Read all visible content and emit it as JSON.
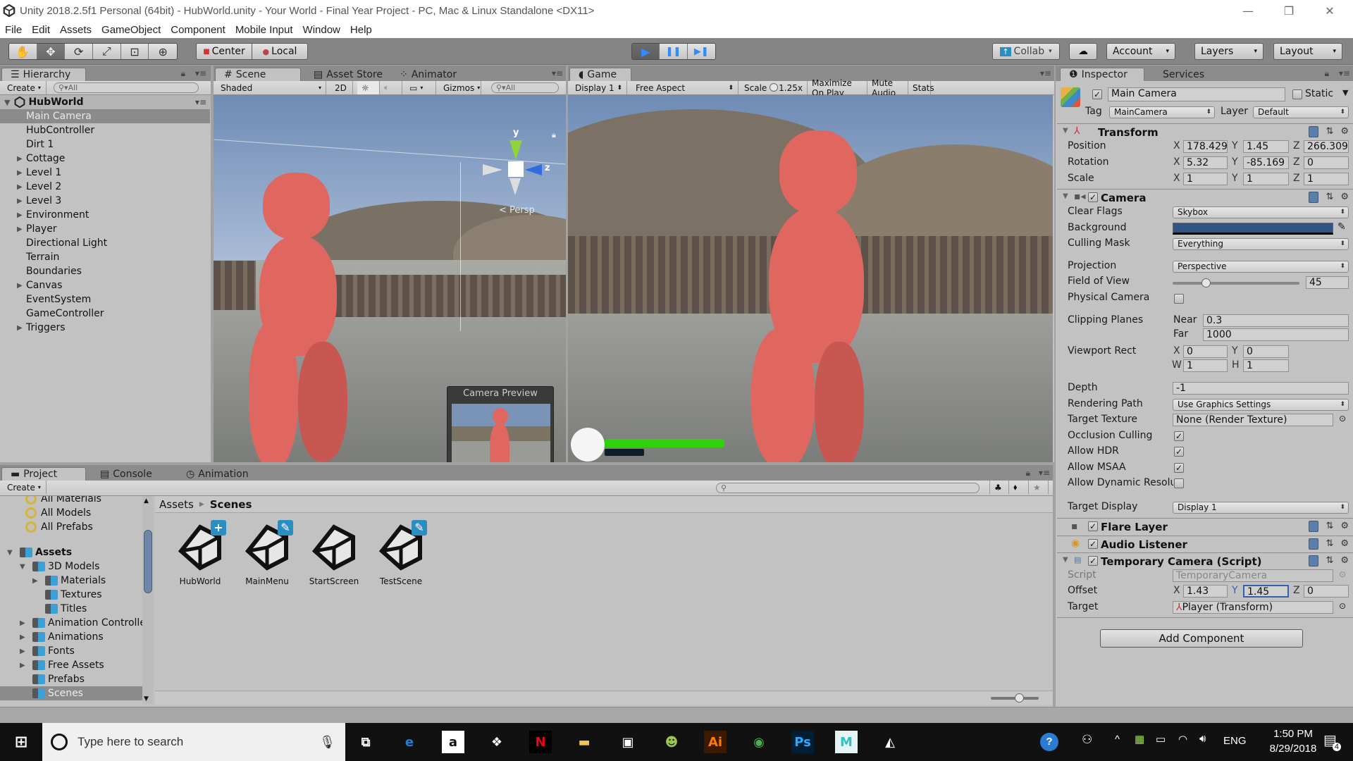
{
  "window": {
    "title": "Unity 2018.2.5f1 Personal (64bit) - HubWorld.unity - Your World - Final Year Project - PC, Mac & Linux Standalone <DX11>",
    "controls": {
      "minimize": "—",
      "maximize": "❐",
      "close": "✕"
    }
  },
  "menu": [
    "File",
    "Edit",
    "Assets",
    "GameObject",
    "Component",
    "Mobile Input",
    "Window",
    "Help"
  ],
  "toolbar": {
    "tools": [
      "hand-tool",
      "move-tool",
      "rotate-tool",
      "scale-tool",
      "rect-tool",
      "transform-tool"
    ],
    "tool_glyphs": [
      "✋",
      "✥",
      "⟳",
      "⤢",
      "⊡",
      "⊕"
    ],
    "pivot": "Center",
    "space": "Local",
    "play": "▶",
    "pause": "❚❚",
    "step": "▶❚",
    "collab": "Collab",
    "cloud": "☁",
    "account": "Account",
    "layers": "Layers",
    "layout": "Layout"
  },
  "hierarchy": {
    "tab": "Hierarchy",
    "create": "Create",
    "search_placeholder": "All",
    "scene": "HubWorld",
    "items": [
      {
        "label": "Main Camera",
        "expandable": false,
        "selected": true
      },
      {
        "label": "HubController",
        "expandable": false
      },
      {
        "label": "Dirt 1",
        "expandable": false
      },
      {
        "label": "Cottage",
        "expandable": true
      },
      {
        "label": "Level 1",
        "expandable": true
      },
      {
        "label": "Level 2",
        "expandable": true
      },
      {
        "label": "Level 3",
        "expandable": true
      },
      {
        "label": "Environment",
        "expandable": true
      },
      {
        "label": "Player",
        "expandable": true
      },
      {
        "label": "Directional Light",
        "expandable": false
      },
      {
        "label": "Terrain",
        "expandable": false
      },
      {
        "label": "Boundaries",
        "expandable": false
      },
      {
        "label": "Canvas",
        "expandable": true
      },
      {
        "label": "EventSystem",
        "expandable": false
      },
      {
        "label": "GameController",
        "expandable": false
      },
      {
        "label": "Triggers",
        "expandable": true
      }
    ]
  },
  "scene_view": {
    "tabs": [
      "Scene",
      "Asset Store",
      "Animator"
    ],
    "shading": "Shaded",
    "mode_2d": "2D",
    "gizmos": "Gizmos",
    "search_placeholder": "All",
    "gizmo_labels": {
      "y": "y",
      "z": "z",
      "persp": "< Persp"
    },
    "camera_preview_title": "Camera Preview"
  },
  "game_view": {
    "tab": "Game",
    "display": "Display 1",
    "aspect": "Free Aspect",
    "scale_label": "Scale",
    "scale_value": "1.25x",
    "maximize_on_play": "Maximize On Play",
    "mute_audio": "Mute Audio",
    "stats": "Stats",
    "health_fraction": 1.0,
    "stamina_fraction": 0.33,
    "health_color": "#2fd10d"
  },
  "inspector": {
    "tabs": [
      "Inspector",
      "Services"
    ],
    "object_name": "Main Camera",
    "active": true,
    "static_label": "Static",
    "tag_label": "Tag",
    "tag": "MainCamera",
    "layer_label": "Layer",
    "layer": "Default",
    "transform": {
      "title": "Transform",
      "position": {
        "label": "Position",
        "x": "178.429",
        "y": "1.45",
        "z": "266.309"
      },
      "rotation": {
        "label": "Rotation",
        "x": "5.32",
        "y": "-85.169",
        "z": "0"
      },
      "scale": {
        "label": "Scale",
        "x": "1",
        "y": "1",
        "z": "1"
      }
    },
    "camera": {
      "title": "Camera",
      "enabled": true,
      "clear_flags_label": "Clear Flags",
      "clear_flags": "Skybox",
      "background_label": "Background",
      "background_color": "#2f5486",
      "culling_mask_label": "Culling Mask",
      "culling_mask": "Everything",
      "projection_label": "Projection",
      "projection": "Perspective",
      "fov_label": "Field of View",
      "fov": "45",
      "fov_fraction": 0.26,
      "physical_label": "Physical Camera",
      "physical": false,
      "clipping_label": "Clipping Planes",
      "near_label": "Near",
      "near": "0.3",
      "far_label": "Far",
      "far": "1000",
      "viewport_label": "Viewport Rect",
      "vx": "0",
      "vy": "0",
      "vw": "1",
      "vh": "1",
      "depth_label": "Depth",
      "depth": "-1",
      "rendering_path_label": "Rendering Path",
      "rendering_path": "Use Graphics Settings",
      "target_texture_label": "Target Texture",
      "target_texture": "None (Render Texture)",
      "occlusion_label": "Occlusion Culling",
      "occlusion": true,
      "hdr_label": "Allow HDR",
      "hdr": true,
      "msaa_label": "Allow MSAA",
      "msaa": true,
      "dynres_label": "Allow Dynamic Resolu",
      "dynres": false,
      "target_display_label": "Target Display",
      "target_display": "Display 1"
    },
    "flare_layer": "Flare Layer",
    "audio_listener": "Audio Listener",
    "script_component": {
      "title": "Temporary Camera (Script)",
      "script_label": "Script",
      "script": "TemporaryCamera",
      "offset_label": "Offset",
      "x": "1.43",
      "y": "1.45",
      "z": "0",
      "target_label": "Target",
      "target": "Player (Transform)"
    },
    "add_component": "Add Component"
  },
  "project": {
    "tabs": [
      "Project",
      "Console",
      "Animation"
    ],
    "create": "Create",
    "favorites": [
      "All Materials",
      "All Models",
      "All Prefabs"
    ],
    "tree": [
      {
        "label": "Assets",
        "depth": 0,
        "arrow": "down",
        "bold": true
      },
      {
        "label": "3D Models",
        "depth": 1,
        "arrow": "down"
      },
      {
        "label": "Materials",
        "depth": 2,
        "arrow": "right"
      },
      {
        "label": "Textures",
        "depth": 2,
        "arrow": "none"
      },
      {
        "label": "Titles",
        "depth": 2,
        "arrow": "none"
      },
      {
        "label": "Animation Controller",
        "depth": 1,
        "arrow": "right"
      },
      {
        "label": "Animations",
        "depth": 1,
        "arrow": "right"
      },
      {
        "label": "Fonts",
        "depth": 1,
        "arrow": "right"
      },
      {
        "label": "Free Assets",
        "depth": 1,
        "arrow": "right"
      },
      {
        "label": "Prefabs",
        "depth": 1,
        "arrow": "none"
      },
      {
        "label": "Scenes",
        "depth": 1,
        "arrow": "none",
        "selected": true
      }
    ],
    "breadcrumb": [
      "Assets",
      "Scenes"
    ],
    "assets": [
      {
        "name": "HubWorld",
        "badge": "+"
      },
      {
        "name": "MainMenu",
        "badge": "✎"
      },
      {
        "name": "StartScreen",
        "badge": ""
      },
      {
        "name": "TestScene",
        "badge": "✎"
      }
    ]
  },
  "taskbar": {
    "search_placeholder": "Type here to search",
    "apps": [
      "task-view",
      "edge",
      "amazon",
      "dropbox",
      "netflix",
      "file-explorer",
      "store",
      "android-studio",
      "illustrator",
      "chrome",
      "photoshop",
      "maya",
      "unity"
    ],
    "app_glyphs": [
      "⧉",
      "e",
      "a",
      "❖",
      "N",
      "▬",
      "▣",
      "☻",
      "Ai",
      "◉",
      "Ps",
      "M",
      "◭"
    ],
    "time": "1:50 PM",
    "date": "8/29/2018",
    "language": "ENG",
    "notifications": "4"
  }
}
